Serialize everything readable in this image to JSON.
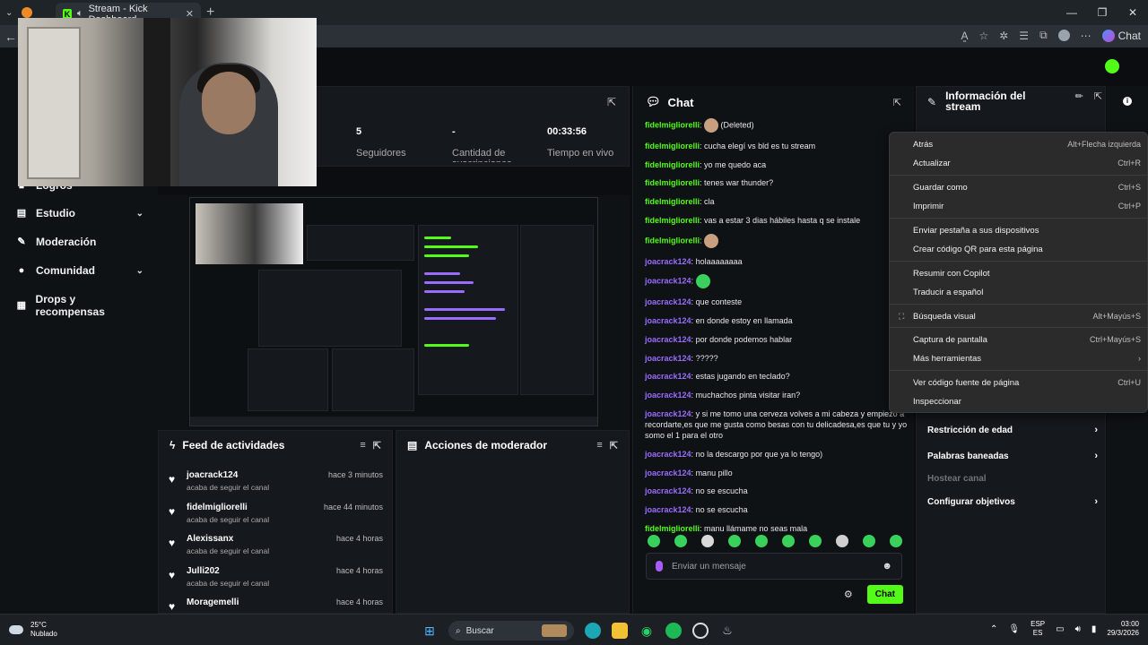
{
  "browser": {
    "tab_title": "Stream - Kick Dashboard",
    "chat_extension_label": "Chat"
  },
  "sidebar": {
    "items": [
      {
        "label": "Logros",
        "icon": "trophy-icon"
      },
      {
        "label": "Estudio",
        "icon": "studio-icon"
      },
      {
        "label": "Moderación",
        "icon": "wrench-icon"
      },
      {
        "label": "Comunidad",
        "icon": "community-icon"
      },
      {
        "label": "Drops y recompensas",
        "icon": "gift-icon"
      }
    ]
  },
  "stats": {
    "followers_value": "5",
    "followers_label": "Seguidores",
    "subs_value": "-",
    "subs_label": "Cantidad de suscripciones",
    "live_value": "00:33:56",
    "live_label": "Tiempo en vivo"
  },
  "feed": {
    "title": "Feed de actividades",
    "items": [
      {
        "user": "joacrack124",
        "when": "hace 3 minutos",
        "action": "acaba de seguir el canal"
      },
      {
        "user": "fidelmigliorelli",
        "when": "hace 44 minutos",
        "action": "acaba de seguir el canal"
      },
      {
        "user": "Alexissanx",
        "when": "hace 4 horas",
        "action": "acaba de seguir el canal"
      },
      {
        "user": "Julli202",
        "when": "hace 4 horas",
        "action": "acaba de seguir el canal"
      },
      {
        "user": "Moragemelli",
        "when": "hace 4 horas",
        "action": ""
      }
    ]
  },
  "moderator": {
    "title": "Acciones de moderador"
  },
  "chat": {
    "title": "Chat",
    "messages": [
      {
        "user": "fidelmigliorelli",
        "color": "green",
        "text": "(Deleted)",
        "emote": true
      },
      {
        "user": "fidelmigliorelli",
        "color": "green",
        "text": "cucha elegí vs bld es tu stream"
      },
      {
        "user": "fidelmigliorelli",
        "color": "green",
        "text": "yo me quedo aca"
      },
      {
        "user": "fidelmigliorelli",
        "color": "green",
        "text": "tenes war thunder?"
      },
      {
        "user": "fidelmigliorelli",
        "color": "green",
        "text": "cla"
      },
      {
        "user": "fidelmigliorelli",
        "color": "green",
        "text": "vas a estar 3 dias hábiles hasta q se instale"
      },
      {
        "user": "fidelmigliorelli",
        "color": "green",
        "text": "",
        "emote": true
      },
      {
        "user": "joacrack124",
        "color": "purple",
        "text": "holaaaaaaaa"
      },
      {
        "user": "joacrack124",
        "color": "purple",
        "text": "",
        "emote": true
      },
      {
        "user": "joacrack124",
        "color": "purple",
        "text": "que conteste"
      },
      {
        "user": "joacrack124",
        "color": "purple",
        "text": "en donde estoy en llamada"
      },
      {
        "user": "joacrack124",
        "color": "purple",
        "text": "por donde podemos hablar"
      },
      {
        "user": "joacrack124",
        "color": "purple",
        "text": "?????"
      },
      {
        "user": "joacrack124",
        "color": "purple",
        "text": "estas jugando en teclado?"
      },
      {
        "user": "joacrack124",
        "color": "purple",
        "text": "muchachos pinta visitar iran?"
      },
      {
        "user": "joacrack124",
        "color": "purple",
        "text": "y si me tomo una cerveza volves a mi cabeza y empiezo a recordarte,es que me gusta como besas con tu delicadesa,es que tu y yo somo el 1 para el otro"
      },
      {
        "user": "joacrack124",
        "color": "purple",
        "text": "no la descargo por que ya lo tengo)"
      },
      {
        "user": "joacrack124",
        "color": "purple",
        "text": "manu pillo"
      },
      {
        "user": "joacrack124",
        "color": "purple",
        "text": "no se escucha"
      },
      {
        "user": "joacrack124",
        "color": "purple",
        "text": "no se escucha"
      },
      {
        "user": "fidelmigliorelli",
        "color": "green",
        "text": "manu llámame no seas mala"
      }
    ],
    "input_placeholder": "Enviar un mensaje",
    "send_label": "Chat"
  },
  "info": {
    "title": "Información del stream",
    "mod_items": [
      {
        "label": "Restricción de edad",
        "enabled": true
      },
      {
        "label": "Palabras baneadas",
        "enabled": true
      },
      {
        "label": "Hostear canal",
        "enabled": false
      },
      {
        "label": "Configurar objetivos",
        "enabled": true
      }
    ]
  },
  "context_menu": {
    "items": [
      {
        "label": "Atrás",
        "shortcut": "Alt+Flecha izquierda"
      },
      {
        "label": "Actualizar",
        "shortcut": "Ctrl+R"
      },
      {
        "label": "Guardar como",
        "shortcut": "Ctrl+S"
      },
      {
        "label": "Imprimir",
        "shortcut": "Ctrl+P"
      },
      {
        "label": "Enviar pestaña a sus dispositivos",
        "shortcut": ""
      },
      {
        "label": "Crear código QR para esta página",
        "shortcut": ""
      },
      {
        "label": "Resumir con Copilot",
        "shortcut": ""
      },
      {
        "label": "Traducir a español",
        "shortcut": ""
      },
      {
        "label": "Búsqueda visual",
        "shortcut": "Alt+Mayús+S"
      },
      {
        "label": "Captura de pantalla",
        "shortcut": "Ctrl+Mayús+S"
      },
      {
        "label": "Más herramientas",
        "shortcut": "›"
      },
      {
        "label": "Ver código fuente de página",
        "shortcut": "Ctrl+U"
      },
      {
        "label": "Inspeccionar",
        "shortcut": ""
      }
    ]
  },
  "taskbar": {
    "temperature": "25°C",
    "weather": "Nublado",
    "search_label": "Buscar",
    "lang_top": "ESP",
    "lang_bottom": "ES",
    "time": "03:00",
    "date": "29/3/2026"
  },
  "colors": {
    "accent_green": "#53fc18",
    "user_purple": "#9b6bff"
  }
}
